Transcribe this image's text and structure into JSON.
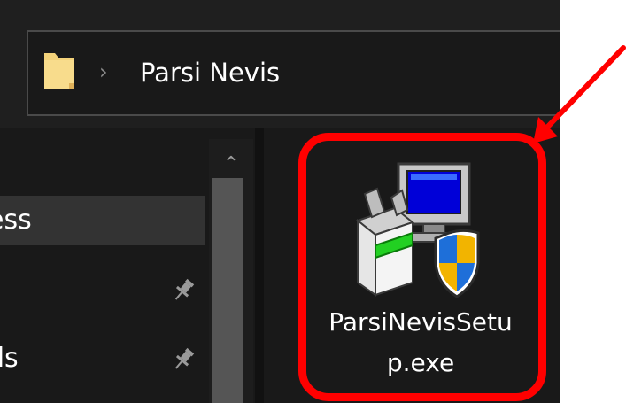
{
  "window": {
    "address_bar": {
      "separator": "›",
      "path": "Parsi Nevis"
    },
    "nav_pane": {
      "items": [
        {
          "label": "ess",
          "pinned": false,
          "selected": true
        },
        {
          "label": "",
          "pinned": true,
          "selected": false
        },
        {
          "label": "ds",
          "pinned": true,
          "selected": false
        }
      ],
      "scroll_up_glyph": "⌃"
    },
    "file_pane": {
      "files": [
        {
          "name": "ParsiNevisSetup.exe",
          "icon": "installer-icon"
        }
      ]
    }
  },
  "annotations": {
    "highlight_color": "#ff0000",
    "arrow_color": "#ff0000"
  },
  "colors": {
    "background": "#191919",
    "text": "#ffffff",
    "selected_row": "#333333",
    "folder_yellow": "#f3d27a"
  }
}
